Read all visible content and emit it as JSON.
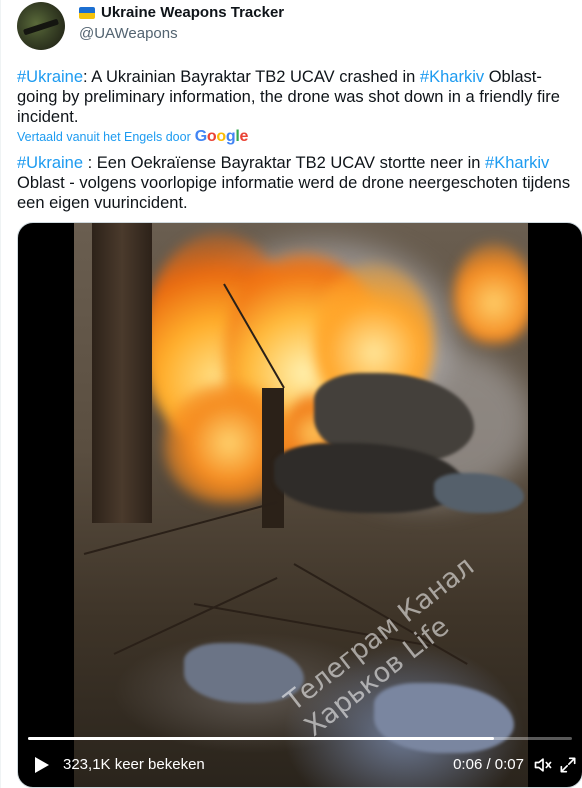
{
  "author": {
    "display_name": "Ukraine Weapons Tracker",
    "handle": "@UAWeapons",
    "flag_icon": "ukraine-flag-icon",
    "flag_colors": [
      "#1c6fd1",
      "#f5c20b"
    ]
  },
  "tweet": {
    "original_parts": [
      {
        "text": "#Ukraine",
        "hashtag": true
      },
      {
        "text": ": A Ukrainian Bayraktar TB2 UCAV crashed in ",
        "hashtag": false
      },
      {
        "text": "#Kharkiv",
        "hashtag": true
      },
      {
        "text": " Oblast- going by preliminary information, the drone was shot down in a friendly fire incident.",
        "hashtag": false
      }
    ],
    "translated_by_label": "Vertaald vanuit het Engels door",
    "translator_logo": "Google",
    "translated_parts": [
      {
        "text": "#Ukraine",
        "hashtag": true
      },
      {
        "text": " : Een Oekraïense Bayraktar TB2 UCAV stortte neer in ",
        "hashtag": false
      },
      {
        "text": "#Kharkiv",
        "hashtag": true
      },
      {
        "text": " Oblast - volgens voorlopige informatie werd de drone neergeschoten tijdens een eigen vuurincident.",
        "hashtag": false
      }
    ]
  },
  "video": {
    "watermark": "Телеграм Канал\nХарьков Life",
    "views_label": "323,1K keer bekeken",
    "time_label": "0:06 / 0:07",
    "progress_fraction": 0.857,
    "play_icon": "play-icon",
    "mute_icon": "mute-icon",
    "expand_icon": "expand-icon"
  },
  "colors": {
    "link": "#1d9bf0",
    "text": "#0f1419",
    "secondary": "#536471"
  }
}
